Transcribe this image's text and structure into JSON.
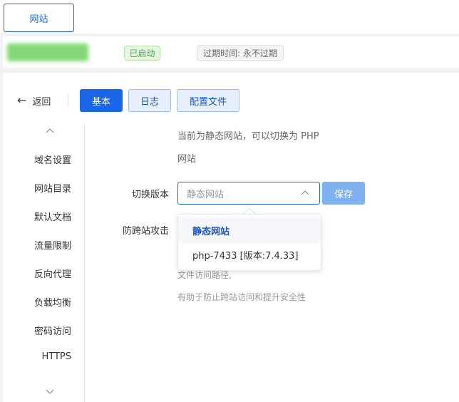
{
  "tabs": {
    "active_label": "网站"
  },
  "info": {
    "status_badge": "已启动",
    "expire_badge": "过期时间: 永不过期",
    "colors": {
      "running_green": "#3db04a",
      "primary_blue": "#1a66e8"
    }
  },
  "toolbar": {
    "back_label": "返回",
    "basic_label": "基本",
    "log_label": "日志",
    "config_label": "配置文件"
  },
  "sidebar": {
    "items": [
      {
        "label": "域名设置"
      },
      {
        "label": "网站目录"
      },
      {
        "label": "默认文档"
      },
      {
        "label": "流量限制"
      },
      {
        "label": "反向代理"
      },
      {
        "label": "负载均衡"
      },
      {
        "label": "密码访问"
      },
      {
        "label": "HTTPS"
      }
    ]
  },
  "content": {
    "desc_line1": "当前为静态网站，可以切换为 PHP",
    "desc_line2": "网站",
    "switch_label": "切换版本",
    "select_placeholder": "静态网站",
    "save_label": "保存",
    "cross_label": "防跨站攻击",
    "hint_line1": "文件访问路径,",
    "hint_line2": "有助于防止跨站访问和提升安全性",
    "options": [
      {
        "label": "静态网站"
      },
      {
        "label": "php-7433 [版本:7.4.33]"
      }
    ]
  }
}
